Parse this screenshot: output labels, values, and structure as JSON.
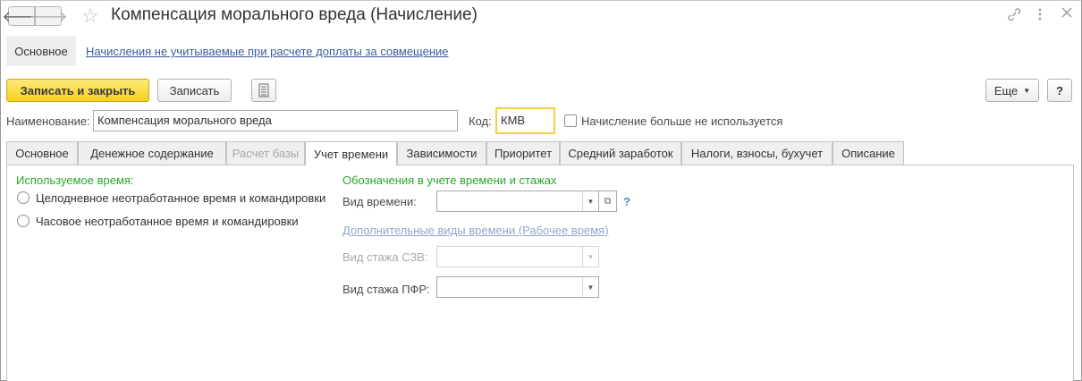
{
  "window": {
    "title": "Компенсация морального вреда (Начисление)",
    "icons": [
      "arrow-left-icon",
      "arrow-right-icon",
      "star-icon",
      "link-icon",
      "more-icon",
      "close-icon"
    ]
  },
  "nav": {
    "main": "Основное",
    "link": "Начисления не учитываемые при расчете доплаты за совмещение"
  },
  "toolbar": {
    "save_close": "Записать и закрыть",
    "save": "Записать",
    "more": "Еще",
    "help": "?"
  },
  "form": {
    "name_label": "Наименование:",
    "name_value": "Компенсация морального вреда",
    "code_label": "Код:",
    "code_value": "КМВ",
    "unused_label": "Начисление больше не используется"
  },
  "tabs": [
    {
      "label": "Основное"
    },
    {
      "label": "Денежное содержание"
    },
    {
      "label": "Расчет базы"
    },
    {
      "label": "Учет времени"
    },
    {
      "label": "Зависимости"
    },
    {
      "label": "Приоритет"
    },
    {
      "label": "Средний заработок"
    },
    {
      "label": "Налоги, взносы, бухучет"
    },
    {
      "label": "Описание"
    }
  ],
  "time_tab": {
    "used_time_title": "Используемое время:",
    "option_full_day": "Целодневное неотработанное время и командировки",
    "option_hourly": "Часовое неотработанное время и командировки",
    "designations_title": "Обозначения в учете времени и стажах",
    "time_type_label": "Вид времени:",
    "help": "?",
    "extra_link": "Дополнительные виды времени (Рабочее время)",
    "szv_label": "Вид стажа СЗВ:",
    "pfr_label": "Вид стажа ПФР:"
  }
}
